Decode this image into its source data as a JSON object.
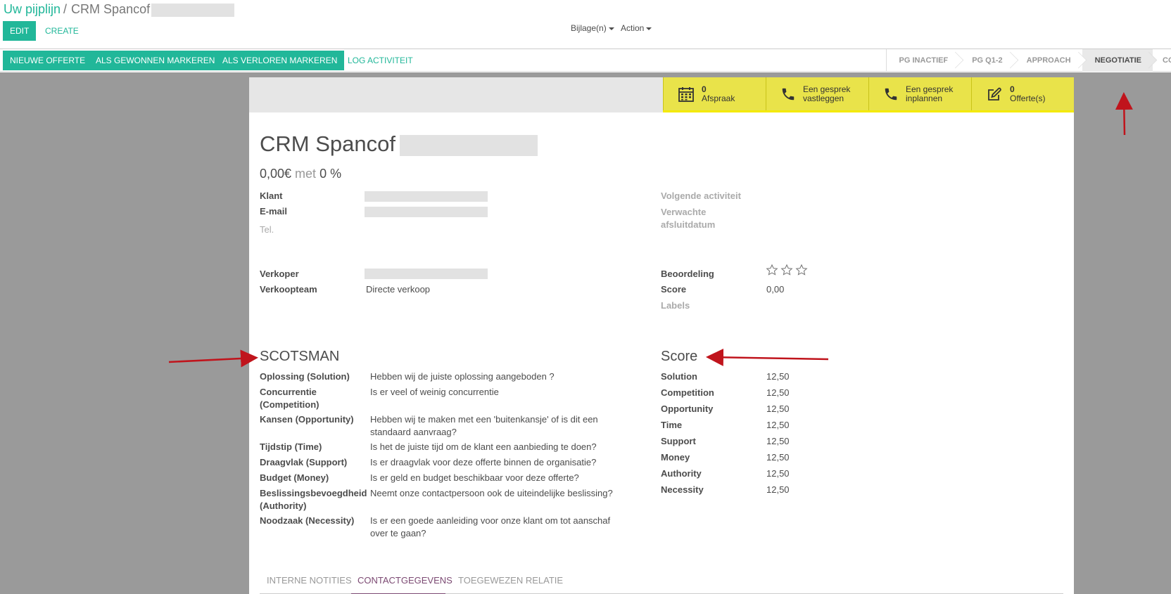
{
  "breadcrumb": {
    "parent": "Uw pijplijn",
    "separator": "/",
    "current": "CRM Spancof"
  },
  "control_buttons": {
    "edit": "EDIT",
    "create": "CREATE"
  },
  "sidebar": {
    "attachments": "Bijlage(n)",
    "action": "Action"
  },
  "status_buttons": {
    "new_quote": "NIEUWE OFFERTE",
    "mark_won": "ALS GEWONNEN MARKEREN",
    "mark_lost": "ALS VERLOREN MARKEREN",
    "log_activity": "LOG ACTIVITEIT"
  },
  "stages": [
    "PG INACTIEF",
    "PG Q1-2",
    "APPROACH",
    "NEGOTIATIE",
    "CO"
  ],
  "active_stage": "NEGOTIATIE",
  "smart_buttons": [
    {
      "icon": "calendar-icon",
      "count": "0",
      "label": "Afspraak"
    },
    {
      "icon": "phone-icon",
      "line1": "Een gesprek",
      "line2": "vastleggen"
    },
    {
      "icon": "phone-icon",
      "line1": "Een gesprek",
      "line2": "inplannen"
    },
    {
      "icon": "edit-icon",
      "count": "0",
      "label": "Offerte(s)"
    }
  ],
  "record": {
    "title": "CRM Spancof",
    "revenue": "0,00€",
    "with": "met",
    "probability": "0 %"
  },
  "left_fields": {
    "customer": "Klant",
    "email": "E-mail",
    "phone": "Tel.",
    "salesperson": "Verkoper",
    "sales_team_label": "Verkoopteam",
    "sales_team_value": "Directe verkoop"
  },
  "right_fields": {
    "next_activity": "Volgende activiteit",
    "expected_close": "Verwachte afsluitdatum",
    "rating_label": "Beoordeling",
    "rating": 0,
    "score_label": "Score",
    "score_value": "0,00",
    "tags": "Labels"
  },
  "scotsman": {
    "title": "SCOTSMAN",
    "rows": [
      {
        "label": "Oplossing (Solution)",
        "value": "Hebben wij de juiste oplossing aangeboden ?"
      },
      {
        "label": "Concurrentie (Competition)",
        "value": "Is er veel of weinig concurrentie"
      },
      {
        "label": "Kansen (Opportunity)",
        "value": "Hebben wij te maken met een 'buitenkansje' of is dit een standaard aanvraag?"
      },
      {
        "label": "Tijdstip (Time)",
        "value": "Is het de juiste tijd om de klant een aanbieding te doen?"
      },
      {
        "label": "Draagvlak (Support)",
        "value": "Is er draagvlak voor deze offerte binnen de organisatie?"
      },
      {
        "label": "Budget (Money)",
        "value": "Is er geld en budget beschikbaar voor deze offerte?"
      },
      {
        "label": "Beslissingsbevoegdheid (Authority)",
        "value": "Neemt onze contactpersoon ook de uiteindelijke beslissing?"
      },
      {
        "label": "Noodzaak (Necessity)",
        "value": "Is er een goede aanleiding voor onze klant om tot aanschaf over te gaan?"
      }
    ]
  },
  "score_section": {
    "title": "Score",
    "rows": [
      {
        "label": "Solution",
        "value": "12,50"
      },
      {
        "label": "Competition",
        "value": "12,50"
      },
      {
        "label": "Opportunity",
        "value": "12,50"
      },
      {
        "label": "Time",
        "value": "12,50"
      },
      {
        "label": "Support",
        "value": "12,50"
      },
      {
        "label": "Money",
        "value": "12,50"
      },
      {
        "label": "Authority",
        "value": "12,50"
      },
      {
        "label": "Necessity",
        "value": "12,50"
      }
    ]
  },
  "notebook_tabs": [
    "INTERNE NOTITIES",
    "CONTACTGEGEVENS",
    "TOEGEWEZEN RELATIE"
  ],
  "active_tab": "CONTACTGEGEVENS",
  "colors": {
    "primary": "#21b799",
    "smart_button": "#e9e34a",
    "annotation_arrow": "#c0141c",
    "tab_active": "#7c4a73"
  }
}
